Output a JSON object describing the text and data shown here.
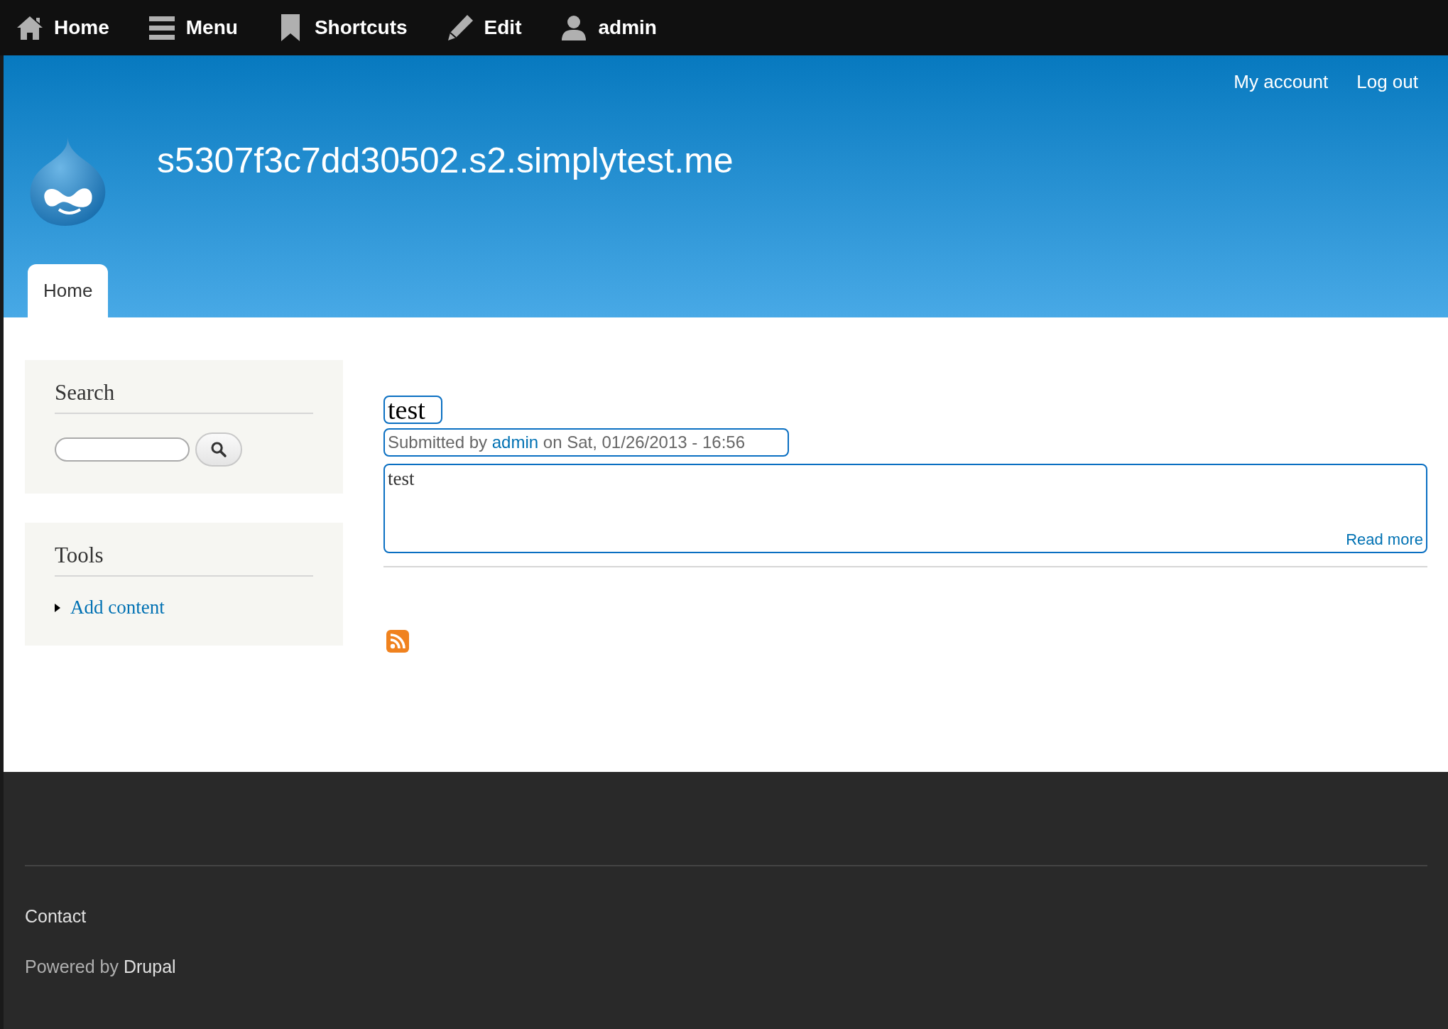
{
  "toolbar": {
    "items": [
      {
        "label": "Home"
      },
      {
        "label": "Menu"
      },
      {
        "label": "Shortcuts"
      },
      {
        "label": "Edit"
      },
      {
        "label": "admin"
      }
    ]
  },
  "secondary_menu": [
    "My account",
    "Log out"
  ],
  "site_name": "s5307f3c7dd30502.s2.simplytest.me",
  "tabs": [
    {
      "label": "Home",
      "selected": true
    }
  ],
  "sidebar": {
    "search": {
      "title": "Search"
    },
    "tools": {
      "title": "Tools",
      "links": [
        "Add content"
      ]
    }
  },
  "node": {
    "title": "test",
    "meta": {
      "prefix": "Submitted by",
      "author": "admin",
      "suffix": "on Sat, 01/26/2013 - 16:56"
    },
    "body": "test",
    "read_more": "Read more"
  },
  "footer": {
    "links": [
      "Contact"
    ],
    "powered": {
      "prefix": "Powered by",
      "link": "Drupal"
    }
  }
}
